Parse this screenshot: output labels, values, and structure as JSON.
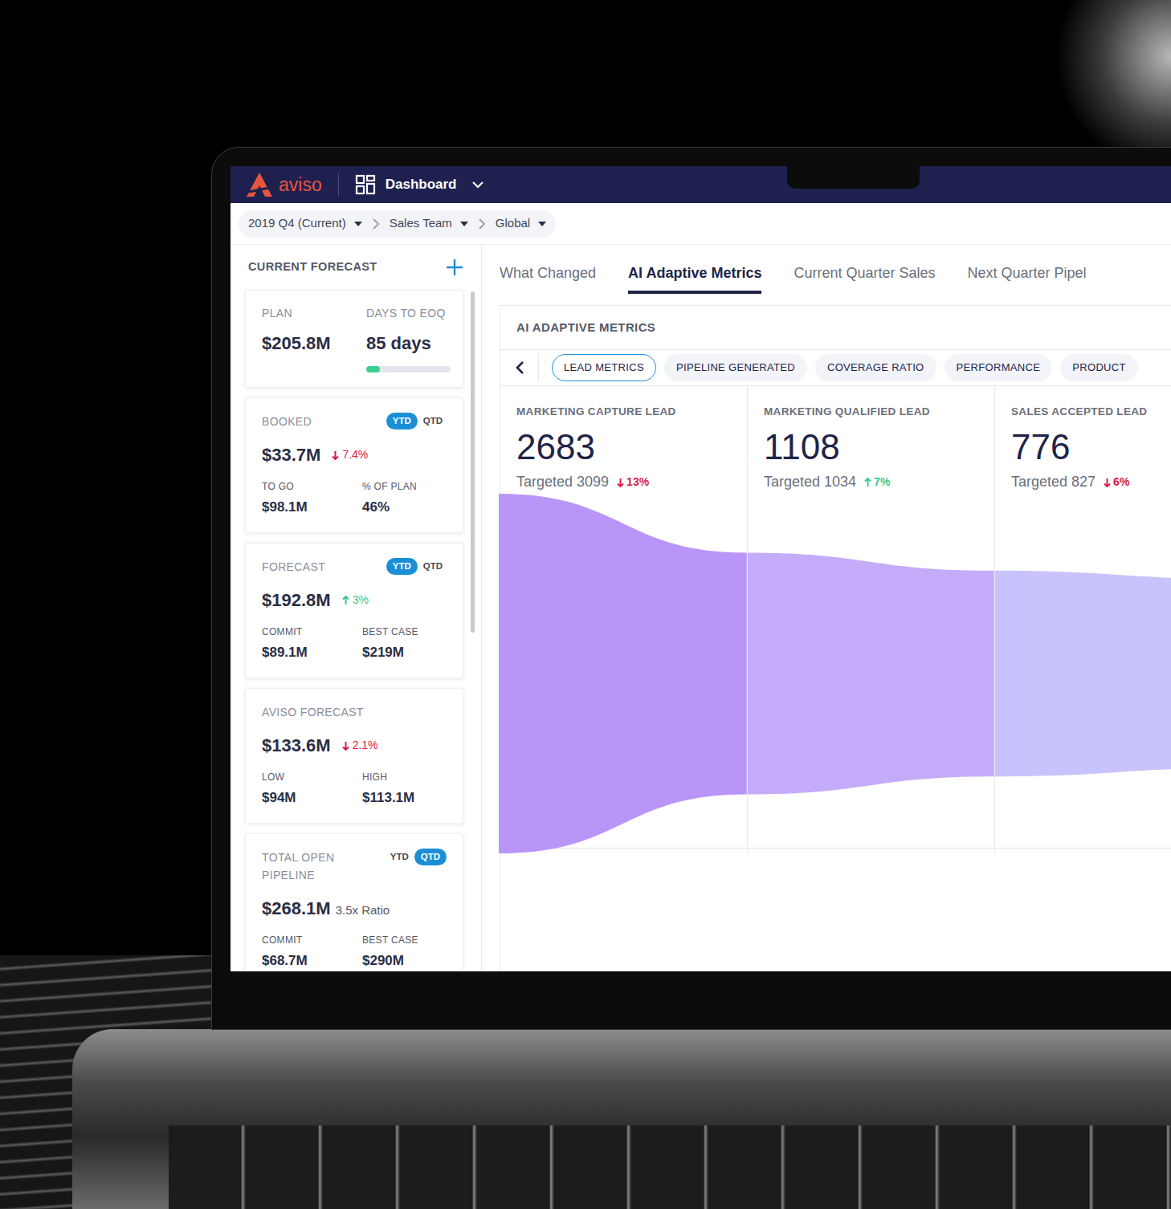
{
  "app": {
    "logo": "aviso",
    "view": "Dashboard"
  },
  "breadcrumb": [
    {
      "label": "2019 Q4 (Current)"
    },
    {
      "label": "Sales Team"
    },
    {
      "label": "Global"
    }
  ],
  "sidebar": {
    "title": "CURRENT FORECAST",
    "cards": [
      {
        "kind": "plan",
        "left": {
          "label": "PLAN",
          "value": "$205.8M"
        },
        "right": {
          "label": "DAYS TO EOQ",
          "value": "85 days"
        },
        "level": 0.16
      },
      {
        "kind": "metric",
        "title": "BOOKED",
        "toggle": [
          {
            "label": "YTD",
            "selected": true
          },
          {
            "label": "QTD",
            "selected": false
          }
        ],
        "value": "$33.7M",
        "delta": {
          "text": "7.4%",
          "direction": "down"
        },
        "sub": [
          {
            "label": "TO GO",
            "value": "$98.1M"
          },
          {
            "label": "% OF PLAN",
            "value": "46%"
          }
        ]
      },
      {
        "kind": "metric",
        "title": "FORECAST",
        "toggle": [
          {
            "label": "YTD",
            "selected": true
          },
          {
            "label": "QTD",
            "selected": false
          }
        ],
        "value": "$192.8M",
        "delta": {
          "text": "3%",
          "direction": "up"
        },
        "sub": [
          {
            "label": "COMMIT",
            "value": "$89.1M"
          },
          {
            "label": "BEST CASE",
            "value": "$219M"
          }
        ]
      },
      {
        "kind": "metric",
        "title": "AVISO FORECAST",
        "toggle": [],
        "value": "$133.6M",
        "delta": {
          "text": "2.1%",
          "direction": "down"
        },
        "sub": [
          {
            "label": "LOW",
            "value": "$94M"
          },
          {
            "label": "HIGH",
            "value": "$113.1M"
          }
        ]
      },
      {
        "kind": "metric",
        "title": "TOTAL OPEN PIPELINE",
        "toggle": [
          {
            "label": "YTD",
            "selected": false
          },
          {
            "label": "QTD",
            "selected": true
          }
        ],
        "value": "$268.1M",
        "note": "3.5x Ratio",
        "sub": [
          {
            "label": "COMMIT",
            "value": "$68.7M"
          },
          {
            "label": "BEST CASE",
            "value": "$290M"
          }
        ]
      }
    ]
  },
  "tabs": [
    {
      "label": "What Changed",
      "selected": false
    },
    {
      "label": "AI Adaptive Metrics",
      "selected": true
    },
    {
      "label": "Current Quarter Sales",
      "selected": false
    },
    {
      "label": "Next Quarter Pipel",
      "selected": false
    }
  ],
  "panel": {
    "title": "AI ADAPTIVE METRICS",
    "chips": [
      {
        "label": "LEAD METRICS",
        "selected": true
      },
      {
        "label": "PIPELINE GENERATED",
        "selected": false
      },
      {
        "label": "COVERAGE RATIO",
        "selected": false
      },
      {
        "label": "PERFORMANCE",
        "selected": false
      },
      {
        "label": "PRODUCT",
        "selected": false
      }
    ],
    "metrics": [
      {
        "label": "MARKETING CAPTURE LEAD",
        "value": "2683",
        "target": "Targeted 3099",
        "delta": {
          "text": "13%",
          "direction": "down"
        }
      },
      {
        "label": "MARKETING QUALIFIED LEAD",
        "value": "1108",
        "target": "Targeted 1034",
        "delta": {
          "text": "7%",
          "direction": "up"
        }
      },
      {
        "label": "SALES ACCEPTED LEAD",
        "value": "776",
        "target": "Targeted 827",
        "delta": {
          "text": "6%",
          "direction": "down"
        }
      }
    ]
  },
  "funnel": {
    "values": [
      2683,
      1108,
      776
    ]
  }
}
